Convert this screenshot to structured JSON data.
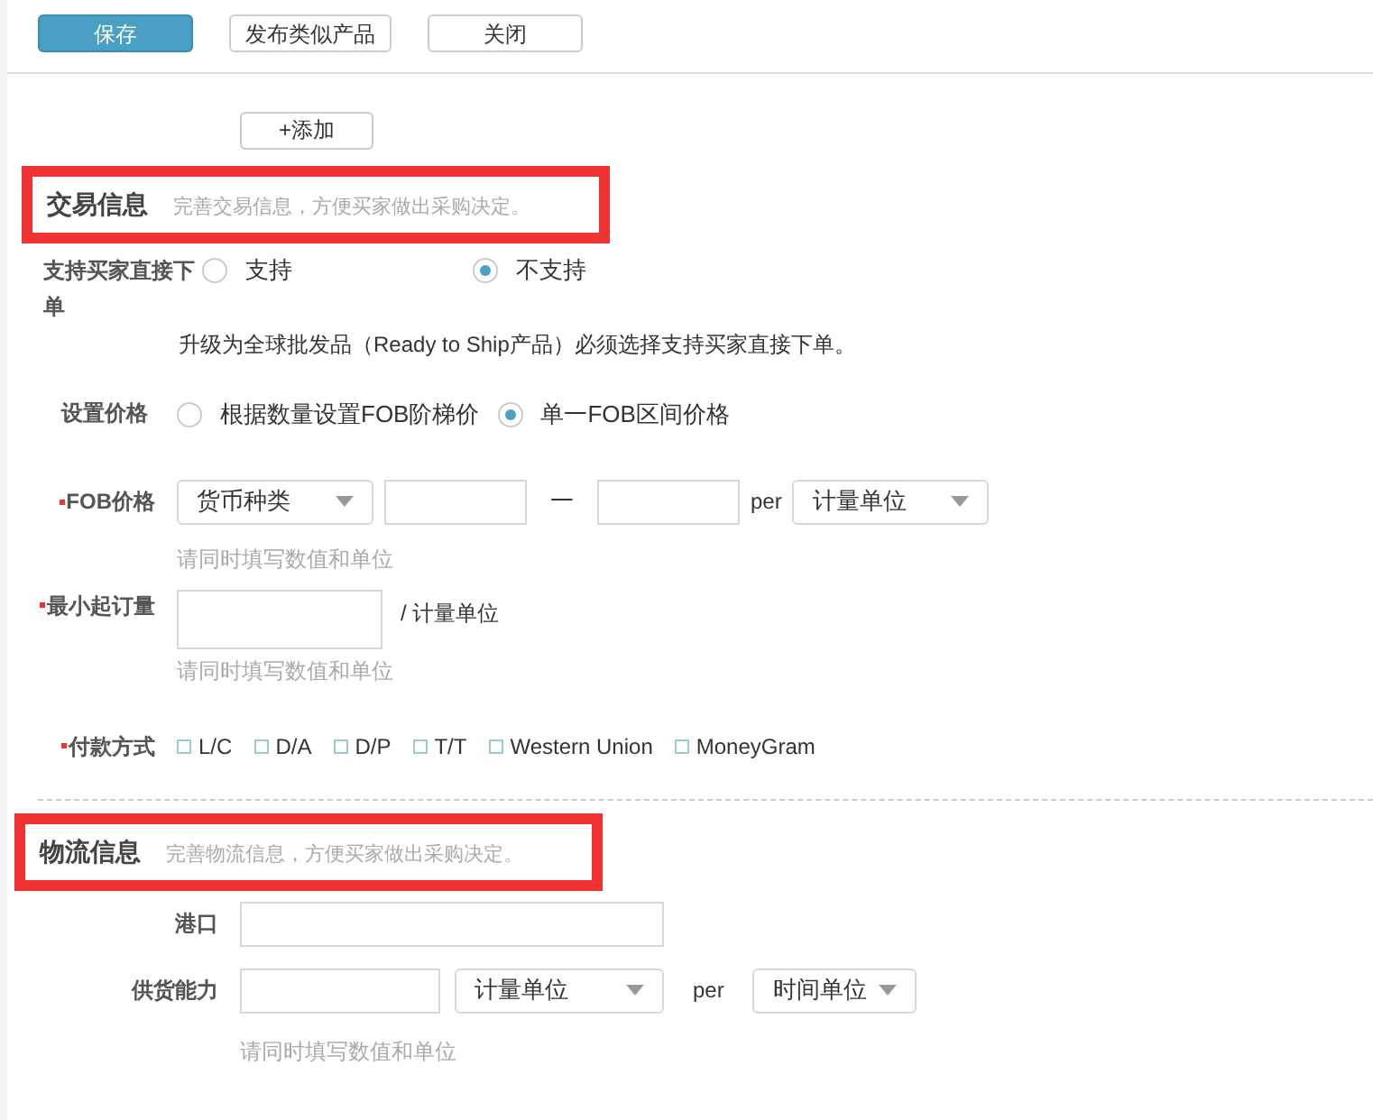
{
  "toolbar": {
    "buttons": [
      {
        "label": "保存",
        "kind": "primary"
      },
      {
        "label": "发布类似产品",
        "kind": "default"
      },
      {
        "label": "关闭",
        "kind": "default"
      }
    ]
  },
  "add_button": {
    "label": "+添加"
  },
  "trade_section": {
    "title": "交易信息",
    "hint": "完善交易信息，方便买家做出采购决定。",
    "highlighted": true,
    "direct_order": {
      "label": "支持买家直接下单",
      "options": [
        {
          "label": "支持",
          "selected": false
        },
        {
          "label": "不支持",
          "selected": true
        }
      ],
      "note": "升级为全球批发品（Ready to Ship产品）必须选择支持买家直接下单。"
    },
    "price_setting": {
      "label": "设置价格",
      "options": [
        {
          "label": "根据数量设置FOB阶梯价",
          "selected": false
        },
        {
          "label": "单一FOB区间价格",
          "selected": true
        }
      ]
    },
    "fob_price": {
      "label": "FOB价格",
      "required": true,
      "currency_select": "货币种类",
      "separator": "一",
      "per": "per",
      "unit_select": "计量单位",
      "hint": "请同时填写数值和单位"
    },
    "min_order": {
      "label": "最小起订量",
      "required": true,
      "unit": "/ 计量单位",
      "hint": "请同时填写数值和单位"
    },
    "payment": {
      "label": "付款方式",
      "required": true,
      "options": [
        {
          "label": "L/C",
          "checked": false
        },
        {
          "label": "D/A",
          "checked": false
        },
        {
          "label": "D/P",
          "checked": false
        },
        {
          "label": "T/T",
          "checked": false
        },
        {
          "label": "Western Union",
          "checked": false
        },
        {
          "label": "MoneyGram",
          "checked": false
        }
      ]
    }
  },
  "logistics_section": {
    "title": "物流信息",
    "hint": "完善物流信息，方便买家做出采购决定。",
    "highlighted": true,
    "port": {
      "label": "港口"
    },
    "supply": {
      "label": "供货能力",
      "unit_select": "计量单位",
      "per": "per",
      "time_select": "时间单位",
      "hint": "请同时填写数值和单位"
    }
  }
}
